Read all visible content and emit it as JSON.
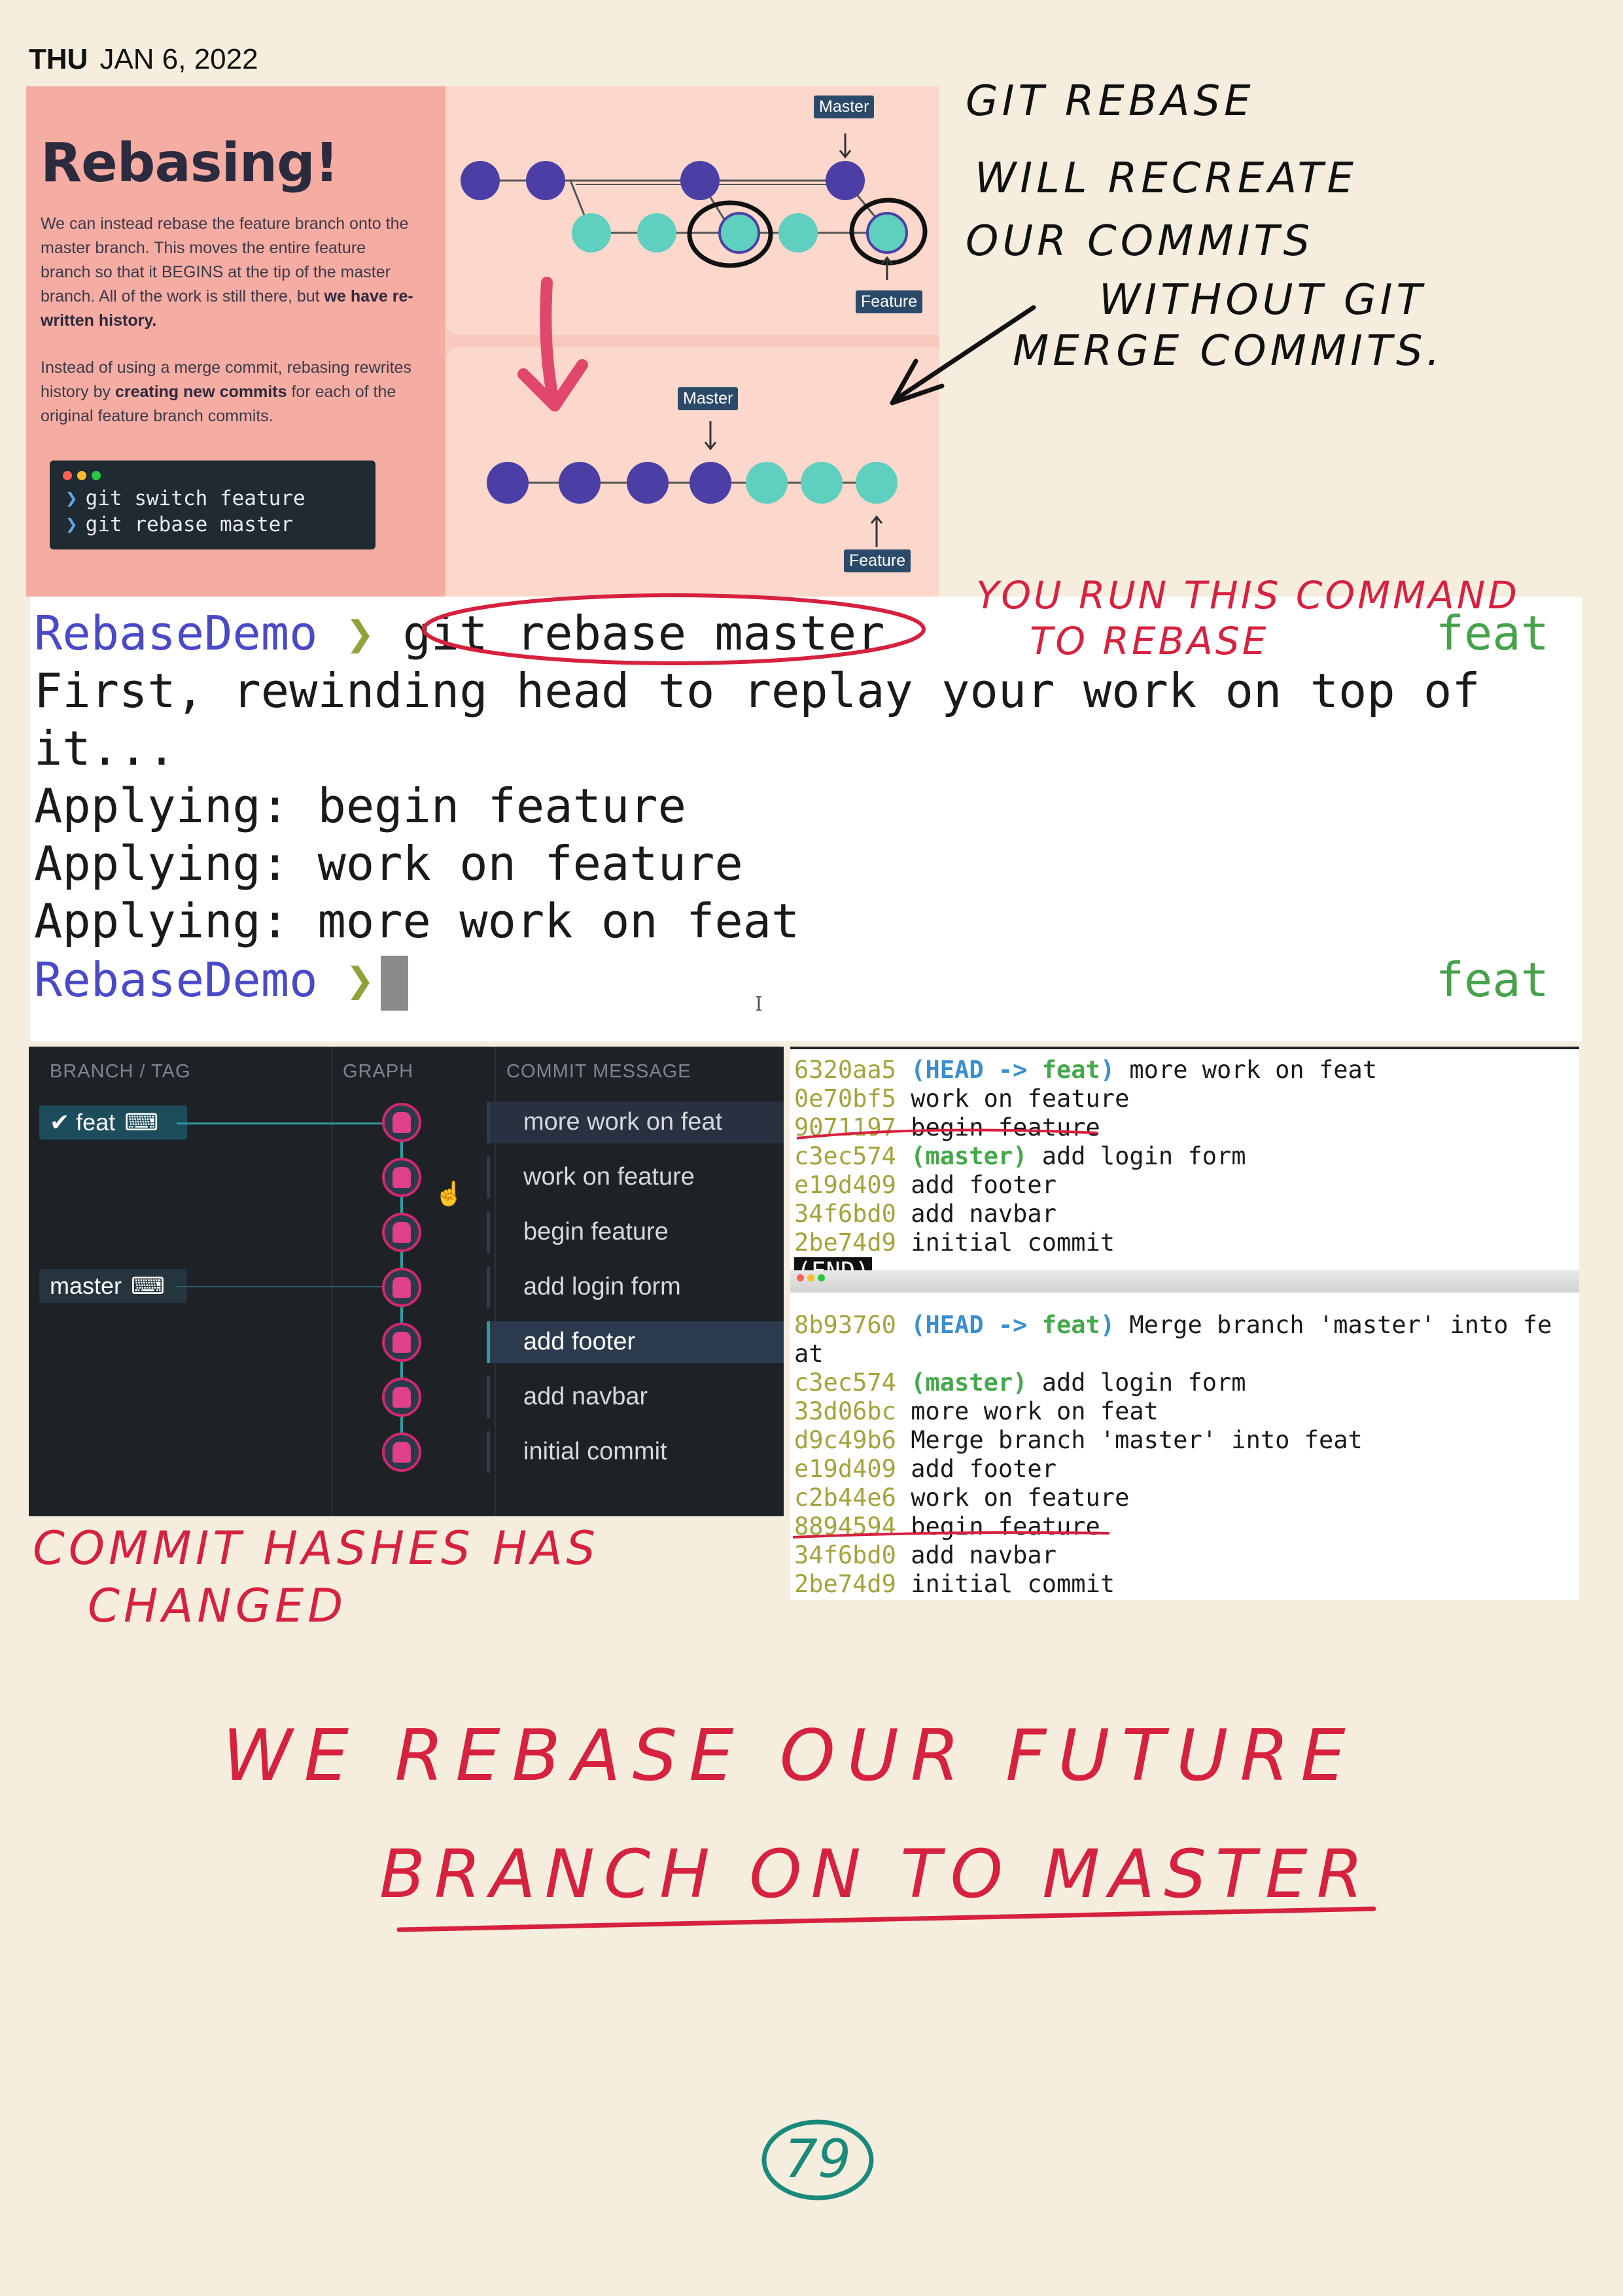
{
  "date": {
    "day": "THU",
    "value": "JAN 6, 2022"
  },
  "slide": {
    "title": "Rebasing!",
    "para1": "We can instead rebase the feature branch onto the master branch.  This moves the entire feature branch so that it BEGINS at the tip of the master branch.  All of the work is still there, but ",
    "para1_bold": "we have re-written history.",
    "para2a": "Instead of using a merge commit, rebasing rewrites history by ",
    "para2_bold": "creating new commits",
    "para2b": " for each of the original feature branch commits.",
    "cmd1": "git switch feature",
    "cmd2": "git rebase master",
    "label_master": "Master",
    "label_feature": "Feature",
    "colors": {
      "main_commit": "#4b3fa6",
      "feature_commit": "#5fcfbf",
      "arrow": "#e0476b"
    }
  },
  "notes": {
    "rebase_line1": "GIT   REBASE",
    "rebase_line2": "WILL  RECREATE",
    "rebase_line3": "OUR   COMMITS",
    "rebase_line4": "WITHOUT   GIT",
    "rebase_line5": "MERGE   COMMITS.",
    "run_line1": "YOU RUN THIS  COMMAND",
    "run_line2": "TO REBASE",
    "hashes_line1": "COMMIT HASHES HAS",
    "hashes_line2": "CHANGED",
    "bottom_line1": "WE   REBASE  OUR FUTURE",
    "bottom_line2": "BRANCH   ON  TO  MASTER",
    "page_number": "79"
  },
  "console": {
    "prompt": "RebaseDemo",
    "chevron": "❯",
    "command": "git rebase master",
    "branch": "feat",
    "line1": "First, rewinding head to replay your work on top of",
    "line2": "it...",
    "line3": "Applying: begin feature",
    "line4": "Applying: work on feature",
    "line5": "Applying: more work on feat",
    "cursor_icon": "I"
  },
  "kraken": {
    "headers": [
      "BRANCH / TAG",
      "GRAPH",
      "COMMIT MESSAGE"
    ],
    "branch_feat": "feat",
    "branch_master": "master",
    "commits": [
      "more work on feat",
      "work on feature",
      "begin feature",
      "add login form",
      "add footer",
      "add navbar",
      "initial commit"
    ]
  },
  "log1": {
    "rows": [
      {
        "hash": "6320aa5",
        "refs": "feat",
        "msg": " more work on feat"
      },
      {
        "hash": "0e70bf5",
        "msg": "work on feature"
      },
      {
        "hash": "9071197",
        "msg": "begin feature"
      },
      {
        "hash": "c3ec574",
        "refs": "master",
        "msg": " add login form"
      },
      {
        "hash": "e19d409",
        "msg": "add footer"
      },
      {
        "hash": "34f6bd0",
        "msg": "add navbar"
      },
      {
        "hash": "2be74d9",
        "msg": "initial commit"
      }
    ],
    "head": "HEAD",
    "arrow": "->",
    "end": "(END)"
  },
  "log2": {
    "row0_hash": "8b93760",
    "row0_msg": " Merge branch 'master' into fe",
    "row0_wrap": "at",
    "rows": [
      {
        "hash": "c3ec574",
        "refs": "master",
        "msg": " add login form"
      },
      {
        "hash": "33d06bc",
        "msg": "more work on feat"
      },
      {
        "hash": "d9c49b6",
        "msg": "Merge branch 'master' into feat"
      },
      {
        "hash": "e19d409",
        "msg": "add footer"
      },
      {
        "hash": "c2b44e6",
        "msg": "work on feature"
      },
      {
        "hash": "8894594",
        "msg": "begin feature"
      },
      {
        "hash": "34f6bd0",
        "msg": "add navbar"
      },
      {
        "hash": "2be74d9",
        "msg": "initial commit"
      }
    ]
  }
}
